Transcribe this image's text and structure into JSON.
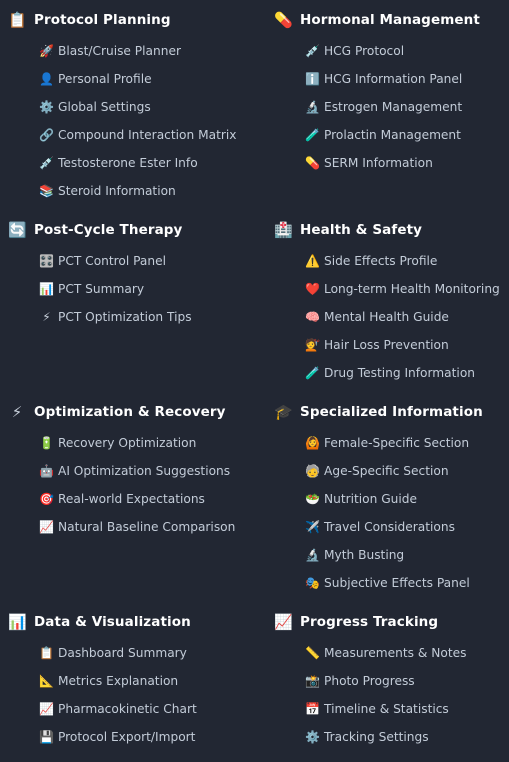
{
  "sections": [
    {
      "icon": "📋",
      "icon_name": "clipboard-icon",
      "title": "Protocol Planning",
      "items": [
        {
          "icon": "🚀",
          "icon_name": "rocket-icon",
          "label": "Blast/Cruise Planner"
        },
        {
          "icon": "👤",
          "icon_name": "person-icon",
          "label": "Personal Profile"
        },
        {
          "icon": "⚙️",
          "icon_name": "gear-icon",
          "label": "Global Settings"
        },
        {
          "icon": "🔗",
          "icon_name": "link-icon",
          "label": "Compound Interaction Matrix"
        },
        {
          "icon": "💉",
          "icon_name": "syringe-icon",
          "label": "Testosterone Ester Info"
        },
        {
          "icon": "📚",
          "icon_name": "books-icon",
          "label": "Steroid Information"
        }
      ]
    },
    {
      "icon": "💊",
      "icon_name": "pill-icon",
      "title": "Hormonal Management",
      "items": [
        {
          "icon": "💉",
          "icon_name": "syringe-icon",
          "label": "HCG Protocol"
        },
        {
          "icon": "ℹ️",
          "icon_name": "info-icon",
          "label": "HCG Information Panel"
        },
        {
          "icon": "🔬",
          "icon_name": "microscope-icon",
          "label": "Estrogen Management"
        },
        {
          "icon": "🧪",
          "icon_name": "test-tube-icon",
          "label": "Prolactin Management"
        },
        {
          "icon": "💊",
          "icon_name": "pill-icon",
          "label": "SERM Information"
        }
      ]
    },
    {
      "icon": "🔄",
      "icon_name": "cycle-arrows-icon",
      "title": "Post-Cycle Therapy",
      "items": [
        {
          "icon": "🎛️",
          "icon_name": "control-knobs-icon",
          "label": "PCT Control Panel"
        },
        {
          "icon": "📊",
          "icon_name": "bar-chart-icon",
          "label": "PCT Summary"
        },
        {
          "icon": "⚡",
          "icon_name": "lightning-icon",
          "label": "PCT Optimization Tips"
        }
      ]
    },
    {
      "icon": "🏥",
      "icon_name": "hospital-icon",
      "title": "Health & Safety",
      "items": [
        {
          "icon": "⚠️",
          "icon_name": "warning-icon",
          "label": "Side Effects Profile"
        },
        {
          "icon": "❤️",
          "icon_name": "heart-icon",
          "label": "Long-term Health Monitoring"
        },
        {
          "icon": "🧠",
          "icon_name": "brain-icon",
          "label": "Mental Health Guide"
        },
        {
          "icon": "💇",
          "icon_name": "haircut-icon",
          "label": "Hair Loss Prevention"
        },
        {
          "icon": "🧪",
          "icon_name": "test-tube-icon",
          "label": "Drug Testing Information"
        }
      ]
    },
    {
      "icon": "⚡",
      "icon_name": "lightning-icon",
      "title": "Optimization & Recovery",
      "items": [
        {
          "icon": "🔋",
          "icon_name": "battery-icon",
          "label": "Recovery Optimization"
        },
        {
          "icon": "🤖",
          "icon_name": "robot-icon",
          "label": "AI Optimization Suggestions"
        },
        {
          "icon": "🎯",
          "icon_name": "target-icon",
          "label": "Real-world Expectations"
        },
        {
          "icon": "📈",
          "icon_name": "chart-up-icon",
          "label": "Natural Baseline Comparison"
        }
      ]
    },
    {
      "icon": "🎓",
      "icon_name": "graduation-cap-icon",
      "title": "Specialized Information",
      "items": [
        {
          "icon": "🙆",
          "icon_name": "woman-gesture-icon",
          "label": "Female-Specific Section"
        },
        {
          "icon": "🧓",
          "icon_name": "older-person-icon",
          "label": "Age-Specific Section"
        },
        {
          "icon": "🥗",
          "icon_name": "salad-icon",
          "label": "Nutrition Guide"
        },
        {
          "icon": "✈️",
          "icon_name": "airplane-icon",
          "label": "Travel Considerations"
        },
        {
          "icon": "🔬",
          "icon_name": "microscope-icon",
          "label": "Myth Busting"
        },
        {
          "icon": "🎭",
          "icon_name": "theater-masks-icon",
          "label": "Subjective Effects Panel"
        }
      ]
    },
    {
      "icon": "📊",
      "icon_name": "bar-chart-icon",
      "title": "Data & Visualization",
      "items": [
        {
          "icon": "📋",
          "icon_name": "clipboard-icon",
          "label": "Dashboard Summary"
        },
        {
          "icon": "📐",
          "icon_name": "triangle-ruler-icon",
          "label": "Metrics Explanation"
        },
        {
          "icon": "📈",
          "icon_name": "chart-up-icon",
          "label": "Pharmacokinetic Chart"
        },
        {
          "icon": "💾",
          "icon_name": "floppy-disk-icon",
          "label": "Protocol Export/Import"
        }
      ]
    },
    {
      "icon": "📈",
      "icon_name": "chart-up-icon",
      "title": "Progress Tracking",
      "items": [
        {
          "icon": "📏",
          "icon_name": "ruler-icon",
          "label": "Measurements & Notes"
        },
        {
          "icon": "📸",
          "icon_name": "camera-icon",
          "label": "Photo Progress"
        },
        {
          "icon": "📅",
          "icon_name": "calendar-icon",
          "label": "Timeline & Statistics"
        },
        {
          "icon": "⚙️",
          "icon_name": "gear-icon",
          "label": "Tracking Settings"
        }
      ]
    }
  ]
}
